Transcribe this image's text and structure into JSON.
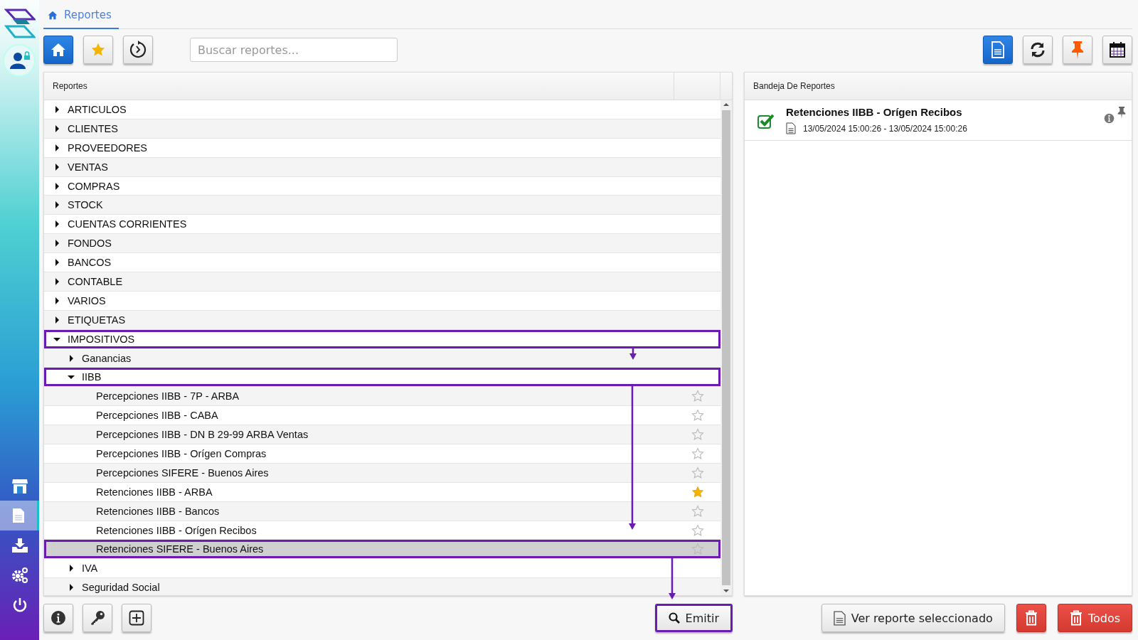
{
  "breadcrumb": {
    "label": "Reportes"
  },
  "sidebar": {
    "items": [
      {
        "kind": "store",
        "selected": false
      },
      {
        "kind": "reports",
        "selected": true
      },
      {
        "kind": "download",
        "selected": false
      },
      {
        "kind": "settings",
        "selected": false
      },
      {
        "kind": "power",
        "selected": false
      }
    ]
  },
  "toolbar": {
    "left_buttons": [
      {
        "kind": "home",
        "selected": true
      },
      {
        "kind": "favorites",
        "selected": false
      },
      {
        "kind": "history",
        "selected": false
      }
    ],
    "search": {
      "placeholder": "Buscar reportes..."
    },
    "right_buttons": [
      {
        "kind": "reports",
        "selected": true
      },
      {
        "kind": "refresh",
        "selected": false
      },
      {
        "kind": "pin",
        "selected": false
      },
      {
        "kind": "calendar",
        "selected": false
      }
    ]
  },
  "tree": {
    "column": "Reportes",
    "items": [
      {
        "label": "ARTICULOS",
        "expanded": false,
        "selected": false,
        "highlighted": false
      },
      {
        "label": "CLIENTES",
        "expanded": false,
        "selected": false,
        "highlighted": false
      },
      {
        "label": "PROVEEDORES",
        "expanded": false,
        "selected": false,
        "highlighted": false
      },
      {
        "label": "VENTAS",
        "expanded": false,
        "selected": false,
        "highlighted": false
      },
      {
        "label": "COMPRAS",
        "expanded": false,
        "selected": false,
        "highlighted": false
      },
      {
        "label": "STOCK",
        "expanded": false,
        "selected": false,
        "highlighted": false
      },
      {
        "label": "CUENTAS CORRIENTES",
        "expanded": false,
        "selected": false,
        "highlighted": false
      },
      {
        "label": "FONDOS",
        "expanded": false,
        "selected": false,
        "highlighted": false
      },
      {
        "label": "BANCOS",
        "expanded": false,
        "selected": false,
        "highlighted": false
      },
      {
        "label": "CONTABLE",
        "expanded": false,
        "selected": false,
        "highlighted": false
      },
      {
        "label": "VARIOS",
        "expanded": false,
        "selected": false,
        "highlighted": false
      },
      {
        "label": "ETIQUETAS",
        "expanded": false,
        "selected": false,
        "highlighted": false
      },
      {
        "label": "IMPOSITIVOS",
        "expanded": true,
        "selected": false,
        "highlighted": true,
        "children": [
          {
            "label": "Ganancias",
            "expanded": false,
            "selected": false,
            "highlighted": false
          },
          {
            "label": "IIBB",
            "expanded": true,
            "selected": false,
            "highlighted": true,
            "children": [
              {
                "label": "Percepciones IIBB - 7P - ARBA",
                "favorite": false,
                "selected": false,
                "highlighted": false
              },
              {
                "label": "Percepciones IIBB - CABA",
                "favorite": false,
                "selected": false,
                "highlighted": false
              },
              {
                "label": "Percepciones IIBB - DN B 29-99 ARBA Ventas",
                "favorite": false,
                "selected": false,
                "highlighted": false
              },
              {
                "label": "Percepciones IIBB - Orígen Compras",
                "favorite": false,
                "selected": false,
                "highlighted": false
              },
              {
                "label": "Percepciones SIFERE - Buenos Aires",
                "favorite": false,
                "selected": false,
                "highlighted": false
              },
              {
                "label": "Retenciones IIBB - ARBA",
                "favorite": true,
                "selected": false,
                "highlighted": false
              },
              {
                "label": "Retenciones IIBB - Bancos",
                "favorite": false,
                "selected": false,
                "highlighted": false
              },
              {
                "label": "Retenciones IIBB - Orígen Recibos",
                "favorite": false,
                "selected": false,
                "highlighted": false
              },
              {
                "label": "Retenciones SIFERE - Buenos Aires",
                "favorite": false,
                "selected": true,
                "highlighted": true
              }
            ]
          },
          {
            "label": "IVA",
            "expanded": false,
            "selected": false,
            "highlighted": false
          },
          {
            "label": "Seguridad Social",
            "expanded": false,
            "selected": false,
            "highlighted": false
          }
        ]
      }
    ]
  },
  "tray": {
    "title": "Bandeja De Reportes",
    "items": [
      {
        "title": "Retenciones IIBB - Orígen Recibos",
        "dates": "13/05/2024 15:00:26 - 13/05/2024 15:00:26",
        "done": true
      }
    ]
  },
  "bottom_left_buttons": [
    {
      "kind": "info"
    },
    {
      "kind": "key"
    },
    {
      "kind": "add"
    }
  ],
  "emit_button": {
    "label": "Emitir",
    "highlighted": true
  },
  "view_button": {
    "label": "Ver reporte seleccionado"
  },
  "delete_button": {
    "kind": "delete"
  },
  "delete_all_button": {
    "label": "Todos"
  }
}
